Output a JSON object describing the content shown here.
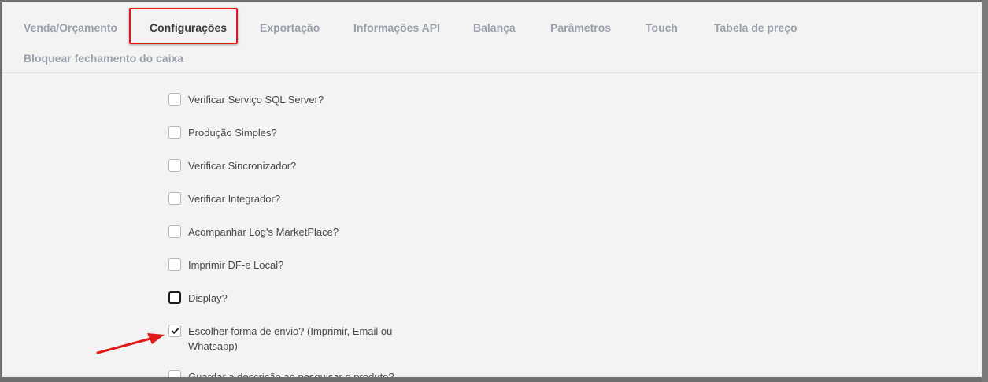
{
  "tabs": [
    {
      "label": "Venda/Orçamento"
    },
    {
      "label": "Configurações"
    },
    {
      "label": "Exportação"
    },
    {
      "label": "Informações API"
    },
    {
      "label": "Balança"
    },
    {
      "label": "Parâmetros"
    },
    {
      "label": "Touch"
    },
    {
      "label": "Tabela de preço"
    },
    {
      "label": "Bloquear fechamento do caixa"
    }
  ],
  "active_tab": "Configurações",
  "options": [
    {
      "label": "Verificar Serviço SQL Server?",
      "checked": false
    },
    {
      "label": "Produção Simples?",
      "checked": false
    },
    {
      "label": "Verificar Sincronizador?",
      "checked": false
    },
    {
      "label": "Verificar Integrador?",
      "checked": false
    },
    {
      "label": "Acompanhar Log's MarketPlace?",
      "checked": false
    },
    {
      "label": "Imprimir DF-e Local?",
      "checked": false
    },
    {
      "label": "Display?",
      "checked": false,
      "focused": true
    },
    {
      "label": "Escolher forma de envio? (Imprimir, Email ou Whatsapp)",
      "checked": true
    },
    {
      "label": "Guardar a descrição ao pesquisar o produto?",
      "checked": false
    }
  ],
  "colors": {
    "highlight": "#e01919",
    "arrow": "#e01919"
  }
}
